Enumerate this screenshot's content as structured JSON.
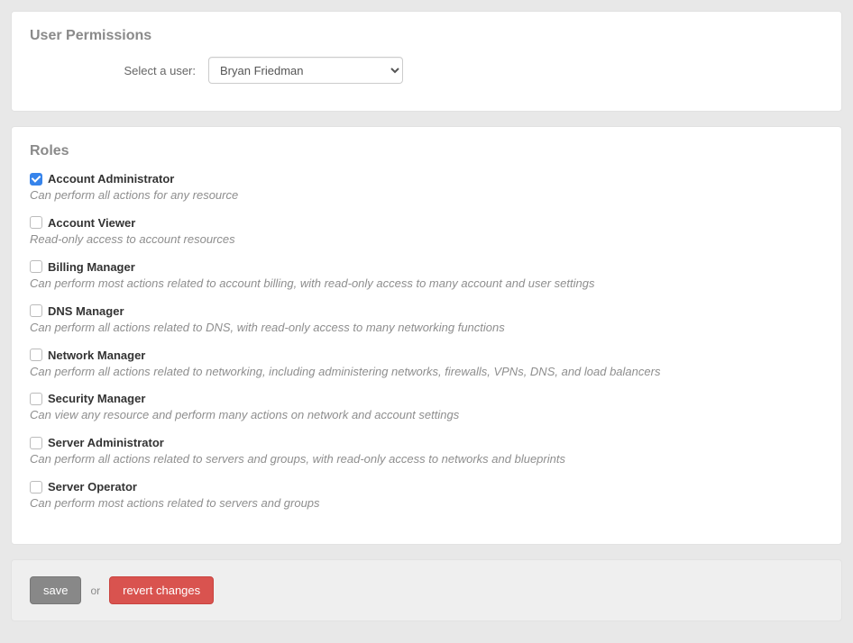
{
  "permissions": {
    "heading": "User Permissions",
    "select_label": "Select a user:",
    "selected_user": "Bryan Friedman"
  },
  "roles_section": {
    "heading": "Roles",
    "roles": [
      {
        "name": "Account Administrator",
        "description": "Can perform all actions for any resource",
        "checked": true
      },
      {
        "name": "Account Viewer",
        "description": "Read-only access to account resources",
        "checked": false
      },
      {
        "name": "Billing Manager",
        "description": "Can perform most actions related to account billing, with read-only access to many account and user settings",
        "checked": false
      },
      {
        "name": "DNS Manager",
        "description": "Can perform all actions related to DNS, with read-only access to many networking functions",
        "checked": false
      },
      {
        "name": "Network Manager",
        "description": "Can perform all actions related to networking, including administering networks, firewalls, VPNs, DNS, and load balancers",
        "checked": false
      },
      {
        "name": "Security Manager",
        "description": "Can view any resource and perform many actions on network and account settings",
        "checked": false
      },
      {
        "name": "Server Administrator",
        "description": "Can perform all actions related to servers and groups, with read-only access to networks and blueprints",
        "checked": false
      },
      {
        "name": "Server Operator",
        "description": "Can perform most actions related to servers and groups",
        "checked": false
      }
    ]
  },
  "actions": {
    "save_label": "save",
    "or_label": "or",
    "revert_label": "revert changes"
  }
}
